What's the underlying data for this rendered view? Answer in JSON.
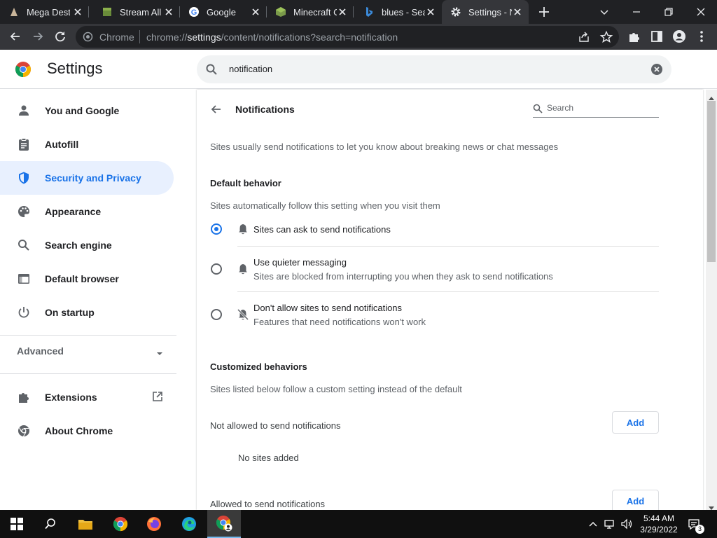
{
  "tabs": [
    {
      "title": "Mega Destiny",
      "icon": "fan-site-icon"
    },
    {
      "title": "Stream All",
      "icon": "minecraft-block-icon"
    },
    {
      "title": "Google",
      "icon": "google-icon"
    },
    {
      "title": "Minecraft C",
      "icon": "minecraft-block-icon"
    },
    {
      "title": "blues - Sea",
      "icon": "bing-icon"
    },
    {
      "title": "Settings - N",
      "icon": "gear-icon",
      "active": true
    }
  ],
  "toolbar": {
    "site_chip": "Chrome",
    "url_host": "chrome://",
    "url_bold": "settings",
    "url_rest": "/content/notifications?search=notification"
  },
  "header": {
    "title": "Settings",
    "search_query": "notification"
  },
  "nav": {
    "items": [
      {
        "label": "You and Google",
        "icon": "person-icon"
      },
      {
        "label": "Autofill",
        "icon": "clipboard-icon"
      },
      {
        "label": "Security and Privacy",
        "icon": "shield-icon",
        "selected": true
      },
      {
        "label": "Appearance",
        "icon": "palette-icon"
      },
      {
        "label": "Search engine",
        "icon": "search-icon"
      },
      {
        "label": "Default browser",
        "icon": "browser-window-icon"
      },
      {
        "label": "On startup",
        "icon": "power-icon"
      }
    ],
    "advanced_label": "Advanced",
    "extensions_label": "Extensions",
    "about_label": "About Chrome"
  },
  "page": {
    "heading": "Notifications",
    "search_placeholder": "Search",
    "intro": "Sites usually send notifications to let you know about breaking news or chat messages",
    "default_behavior": {
      "title": "Default behavior",
      "desc": "Sites automatically follow this setting when you visit them",
      "options": [
        {
          "label": "Sites can ask to send notifications",
          "sub": "",
          "selected": true
        },
        {
          "label": "Use quieter messaging",
          "sub": "Sites are blocked from interrupting you when they ask to send notifications",
          "selected": false
        },
        {
          "label": "Don't allow sites to send notifications",
          "sub": "Features that need notifications won't work",
          "selected": false
        }
      ]
    },
    "customized": {
      "title": "Customized behaviors",
      "desc": "Sites listed below follow a custom setting instead of the default",
      "not_allowed_label": "Not allowed to send notifications",
      "add_label": "Add",
      "empty_label": "No sites added",
      "allowed_label": "Allowed to send notifications"
    }
  },
  "taskbar": {
    "time": "5:44 AM",
    "date": "3/29/2022",
    "notification_count": "3"
  },
  "colors": {
    "accent": "#1a73e8",
    "nav_selected_bg": "#e8f0fe",
    "tabstrip_bg": "#202124",
    "toolbar_bg": "#35363a"
  }
}
